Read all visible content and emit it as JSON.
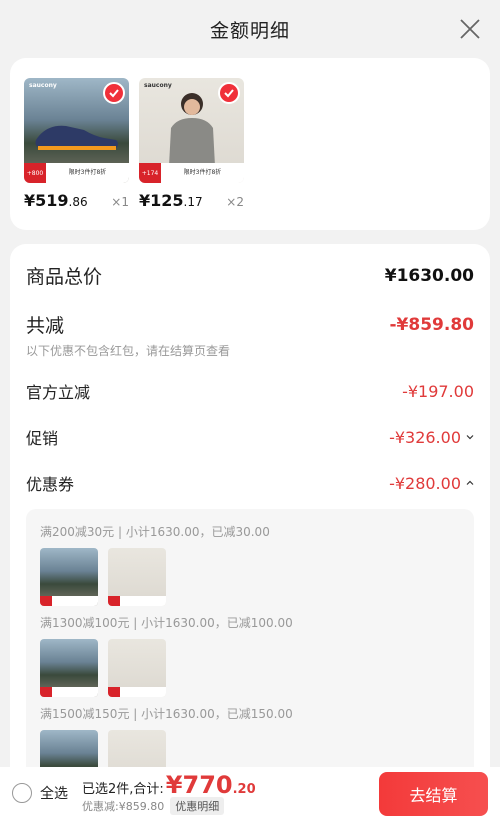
{
  "header": {
    "title": "金额明细"
  },
  "products": [
    {
      "brand": "saucony",
      "promo_a": "+800",
      "promo_b": "限时3件打8折",
      "price_int": "¥519",
      "price_dec": ".86",
      "qty": "×1"
    },
    {
      "brand": "saucony",
      "promo_a": "+174",
      "promo_b": "限时3件打8折",
      "price_int": "¥125",
      "price_dec": ".17",
      "qty": "×2"
    }
  ],
  "detail": {
    "total_label": "商品总价",
    "total_value": "¥1630.00",
    "discount_label": "共减",
    "discount_value": "-¥859.80",
    "discount_note": "以下优惠不包含红包，请在结算页查看",
    "official_label": "官方立减",
    "official_value": "-¥197.00",
    "promo_label": "促销",
    "promo_value": "-¥326.00",
    "coupon_label": "优惠券",
    "coupon_value": "-¥280.00",
    "coupons": [
      "满200减30元 | 小计1630.00，已减30.00",
      "满1300减100元 | 小计1630.00，已减100.00",
      "满1500减150元 | 小计1630.00，已减150.00"
    ]
  },
  "footer": {
    "select_all": "全选",
    "selected_text": "已选2件,合计:",
    "total_int": "¥770",
    "total_dec": ".20",
    "discount_text": "优惠减:¥859.80",
    "detail_tag": "优惠明细",
    "checkout_label": "去结算"
  },
  "colors": {
    "accent": "#e03a3a",
    "check": "#f0303a"
  }
}
